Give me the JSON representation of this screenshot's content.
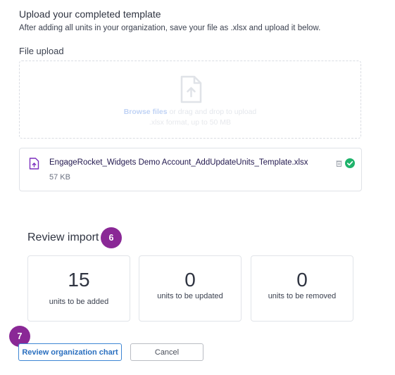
{
  "upload": {
    "title": "Upload your completed template",
    "subtitle": "After adding all units in your organization, save your file as .xlsx and upload it below.",
    "field_label": "File upload",
    "dropzone": {
      "browse_link": "Browse files",
      "rest_line1": " or drag and drop to upload",
      "line2": ".xlsx format, up to 50 MB"
    }
  },
  "file": {
    "name": "EngageRocket_Widgets Demo Account_AddUpdateUnits_Template.xlsx",
    "size": "57 KB",
    "icon": "file-upload-icon",
    "status_icon": "check-circle-icon",
    "delete_icon": "trash-icon"
  },
  "review": {
    "title": "Review import",
    "step_badge": "6",
    "stats": [
      {
        "value": "0",
        "label": ""
      },
      {
        "value": "15",
        "label": "units to be added"
      },
      {
        "value": "0",
        "label": "units to be updated"
      },
      {
        "value": "0",
        "label": "units to be removed"
      }
    ]
  },
  "actions": {
    "step_badge": "7",
    "review_chart": "Review organization chart",
    "cancel": "Cancel"
  },
  "colors": {
    "badge": "#8a2896",
    "primary_link": "#2a6fbf",
    "success": "#1fb36b"
  }
}
